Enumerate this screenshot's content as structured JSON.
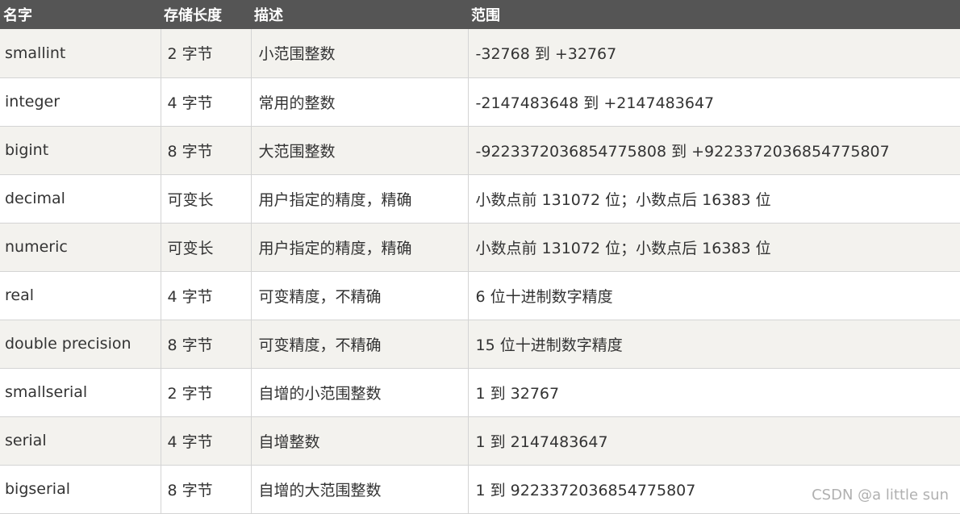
{
  "table": {
    "headers": [
      "名字",
      "存储长度",
      "描述",
      "范围"
    ],
    "rows": [
      [
        "smallint",
        "2 字节",
        "小范围整数",
        "-32768 到 +32767"
      ],
      [
        "integer",
        "4 字节",
        "常用的整数",
        "-2147483648 到 +2147483647"
      ],
      [
        "bigint",
        "8 字节",
        "大范围整数",
        "-9223372036854775808 到 +9223372036854775807"
      ],
      [
        "decimal",
        "可变长",
        "用户指定的精度，精确",
        "小数点前 131072 位；小数点后 16383 位"
      ],
      [
        "numeric",
        "可变长",
        "用户指定的精度，精确",
        "小数点前 131072 位；小数点后 16383 位"
      ],
      [
        "real",
        "4 字节",
        "可变精度，不精确",
        "6 位十进制数字精度"
      ],
      [
        "double precision",
        "8 字节",
        "可变精度，不精确",
        "15 位十进制数字精度"
      ],
      [
        "smallserial",
        "2 字节",
        "自增的小范围整数",
        "1 到 32767"
      ],
      [
        "serial",
        "4 字节",
        "自增整数",
        "1 到 2147483647"
      ],
      [
        "bigserial",
        "8 字节",
        "自增的大范围整数",
        "1 到 9223372036854775807"
      ]
    ]
  },
  "watermark": "CSDN @a little sun",
  "colors": {
    "header_bg": "#555555",
    "header_text": "#ffffff",
    "row_odd": "#f3f2ee",
    "row_even": "#ffffff",
    "text": "#333333",
    "watermark": "#b0b0b0"
  }
}
